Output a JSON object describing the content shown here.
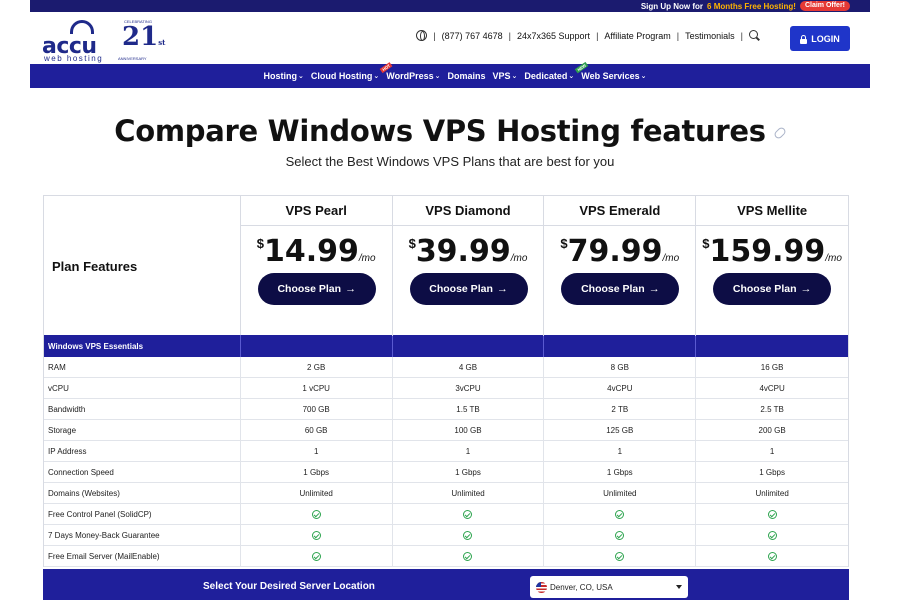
{
  "promo": {
    "text_before": "Sign Up Now for",
    "highlight": "6 Months Free Hosting!",
    "claim": "Claim Offer!"
  },
  "logo": {
    "word": "accu",
    "sub": "web hosting",
    "number": "21",
    "suffix": "st",
    "celebrating": "CELEBRATING",
    "anniversary": "ANNIVERSARY"
  },
  "topnav": {
    "phone": "(877) 767 4678",
    "support": "24x7x365 Support",
    "affiliate": "Affiliate Program",
    "testimonials": "Testimonials",
    "login": "LOGIN"
  },
  "mainnav": {
    "items": [
      {
        "label": "Hosting",
        "caret": true,
        "badge": ""
      },
      {
        "label": "Cloud Hosting",
        "caret": true,
        "badge": ""
      },
      {
        "label": "WordPress",
        "caret": true,
        "badge": "HOT"
      },
      {
        "label": "Domains",
        "caret": false,
        "badge": ""
      },
      {
        "label": "VPS",
        "caret": true,
        "badge": ""
      },
      {
        "label": "Dedicated",
        "caret": true,
        "badge": ""
      },
      {
        "label": "Web Services",
        "caret": true,
        "badge": "NEW"
      }
    ],
    "caret_glyph": "⌄"
  },
  "page": {
    "title": "Compare Windows VPS Hosting features",
    "subtitle": "Select the Best Windows VPS Plans that are best for you"
  },
  "table": {
    "plan_features_label": "Plan Features",
    "choose_label": "Choose Plan",
    "arrow": "→",
    "currency": "$",
    "period": "/mo",
    "plans": [
      {
        "name": "VPS Pearl",
        "price": "14.99"
      },
      {
        "name": "VPS Diamond",
        "price": "39.99"
      },
      {
        "name": "VPS Emerald",
        "price": "79.99"
      },
      {
        "name": "VPS Mellite",
        "price": "159.99"
      }
    ],
    "section": "Windows VPS Essentials",
    "rows": [
      {
        "feature": "RAM",
        "values": [
          "2 GB",
          "4 GB",
          "8 GB",
          "16 GB"
        ]
      },
      {
        "feature": "vCPU",
        "values": [
          "1 vCPU",
          "3vCPU",
          "4vCPU",
          "4vCPU"
        ]
      },
      {
        "feature": "Bandwidth",
        "values": [
          "700 GB",
          "1.5 TB",
          "2 TB",
          "2.5 TB"
        ]
      },
      {
        "feature": "Storage",
        "values": [
          "60 GB",
          "100 GB",
          "125 GB",
          "200 GB"
        ]
      },
      {
        "feature": "IP Address",
        "values": [
          "1",
          "1",
          "1",
          "1"
        ]
      },
      {
        "feature": "Connection Speed",
        "values": [
          "1 Gbps",
          "1 Gbps",
          "1 Gbps",
          "1 Gbps"
        ]
      },
      {
        "feature": "Domains (Websites)",
        "values": [
          "Unlimited",
          "Unlimited",
          "Unlimited",
          "Unlimited"
        ]
      },
      {
        "feature": "Free Control Panel (SolidCP)",
        "values": [
          "check",
          "check",
          "check",
          "check"
        ]
      },
      {
        "feature": "7 Days Money-Back Guarantee",
        "values": [
          "check",
          "check",
          "check",
          "check"
        ]
      },
      {
        "feature": "Free Email Server (MailEnable)",
        "values": [
          "check",
          "check",
          "check",
          "check"
        ]
      }
    ]
  },
  "location": {
    "label": "Select Your Desired Server Location",
    "selected": "Denver, CO, USA"
  }
}
